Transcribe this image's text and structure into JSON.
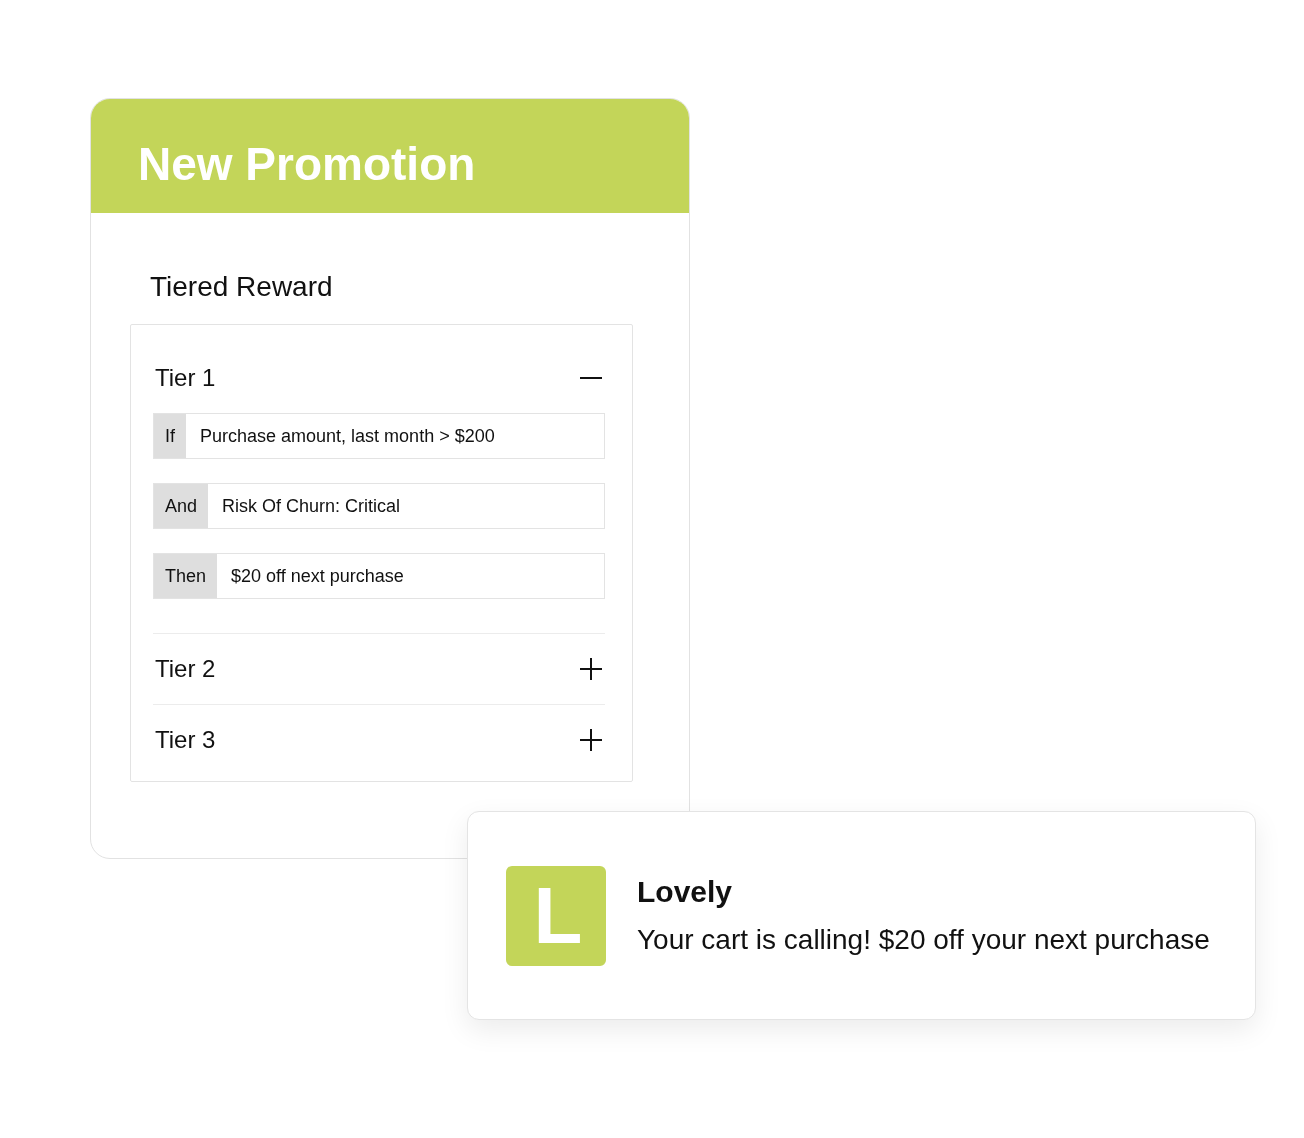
{
  "promotion": {
    "title": "New Promotion",
    "section_title": "Tiered Reward",
    "tiers": [
      {
        "label": "Tier 1",
        "expanded": true,
        "conditions": [
          {
            "operator": "If",
            "value": "Purchase amount, last month > $200"
          },
          {
            "operator": "And",
            "value": "Risk Of Churn: Critical"
          },
          {
            "operator": "Then",
            "value": "$20 off next purchase"
          }
        ]
      },
      {
        "label": "Tier 2",
        "expanded": false
      },
      {
        "label": "Tier 3",
        "expanded": false
      }
    ]
  },
  "notification": {
    "app_letter": "L",
    "title": "Lovely",
    "message": "Your cart is calling! $20 off your next purchase"
  }
}
